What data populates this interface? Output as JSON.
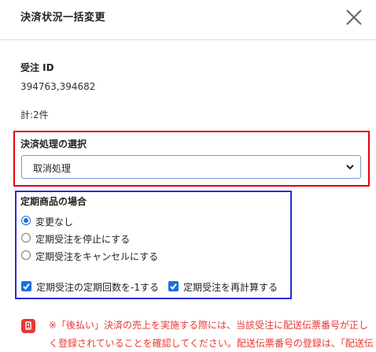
{
  "dialog": {
    "title": "決済状況一括変更"
  },
  "order": {
    "label": "受注 ID",
    "ids": "394763,394682",
    "total": "計:2件"
  },
  "payment_processing": {
    "label": "決済処理の選択",
    "selected": "取消処理"
  },
  "subscription": {
    "label": "定期商品の場合",
    "radio_options": [
      {
        "label": "変更なし",
        "checked": true
      },
      {
        "label": "定期受注を停止にする",
        "checked": false
      },
      {
        "label": "定期受注をキャンセルにする",
        "checked": false
      }
    ],
    "checkboxes": [
      {
        "label": "定期受注の定期回数を-1する",
        "checked": true
      },
      {
        "label": "定期受注を再計算する",
        "checked": true
      }
    ]
  },
  "notice": {
    "icon": "alert-icon",
    "lines": [
      "※「後払い」決済の売上を実施する際には、当該受注に配送伝票番号が正し",
      "く登録されていることを確認してください。配送伝票番号の登録は、「配送伝"
    ]
  },
  "colors": {
    "highlight_red": "#e3000f",
    "highlight_blue": "#2e2ad6",
    "accent": "#1a6fe0",
    "notice": "#e53935"
  }
}
